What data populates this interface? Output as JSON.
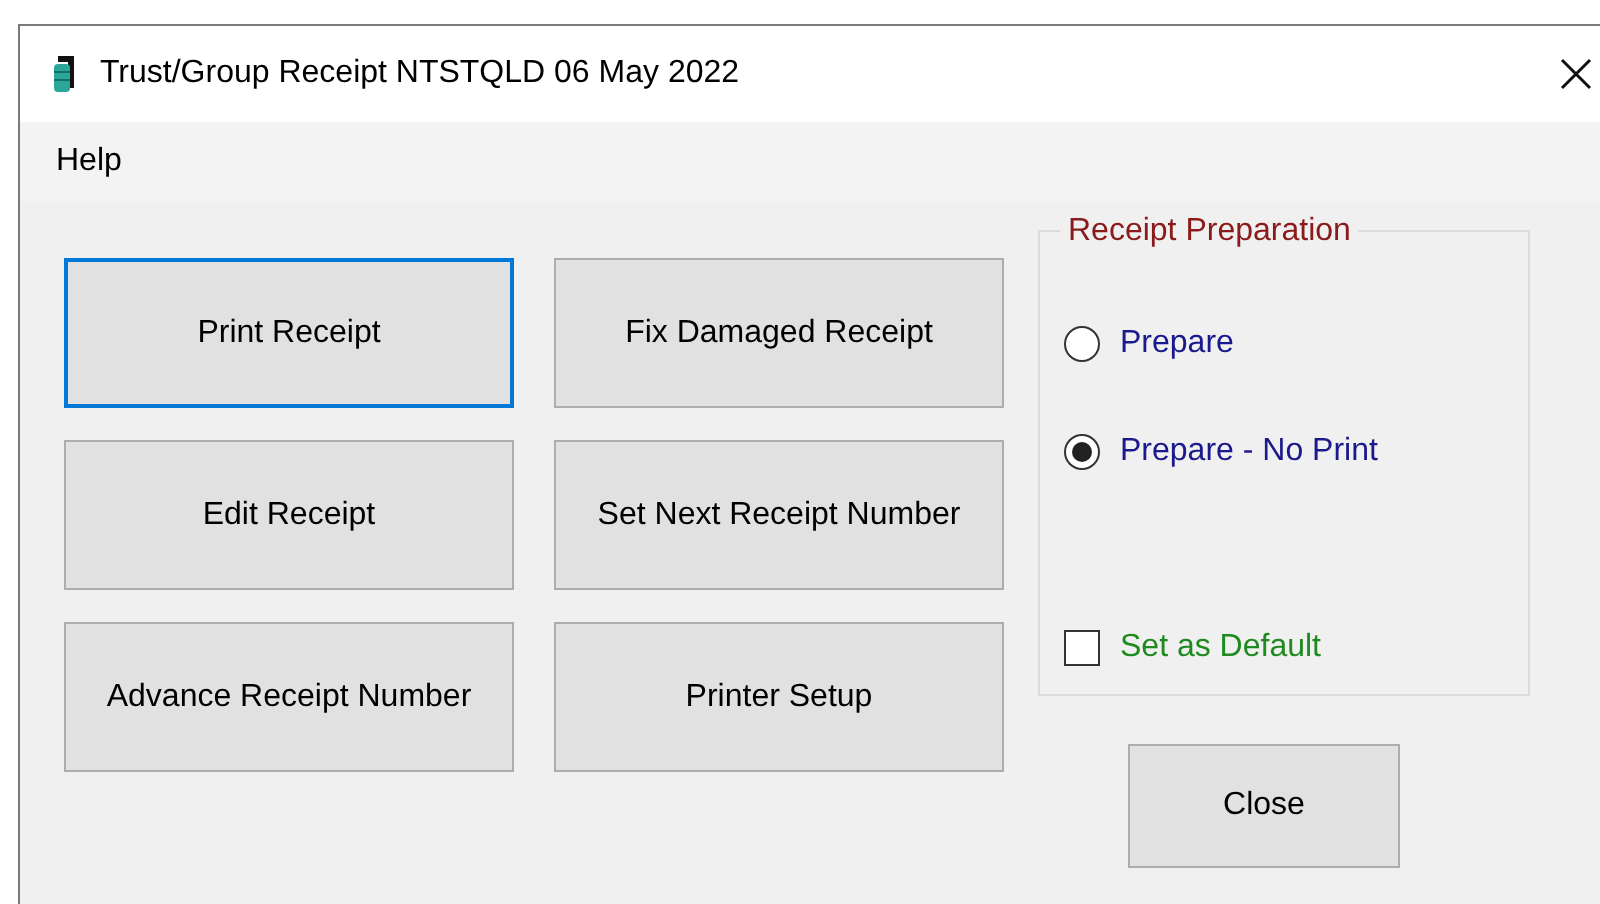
{
  "window": {
    "title": "Trust/Group Receipt NTSTQLD 06 May 2022"
  },
  "menu": [
    {
      "label": "Help"
    }
  ],
  "buttons": [
    {
      "label": "Print Receipt",
      "focused": true
    },
    {
      "label": "Fix Damaged Receipt",
      "focused": false
    },
    {
      "label": "Edit Receipt",
      "focused": false
    },
    {
      "label": "Set Next Receipt Number",
      "focused": false
    },
    {
      "label": "Advance Receipt Number",
      "focused": false
    },
    {
      "label": "Printer Setup",
      "focused": false
    }
  ],
  "receipt_preparation": {
    "title": "Receipt Preparation",
    "options": [
      {
        "label": "Prepare",
        "selected": false
      },
      {
        "label": "Prepare - No Print",
        "selected": true
      }
    ],
    "set_as_default": {
      "label": "Set as Default",
      "checked": false
    }
  },
  "close_button": {
    "label": "Close"
  }
}
